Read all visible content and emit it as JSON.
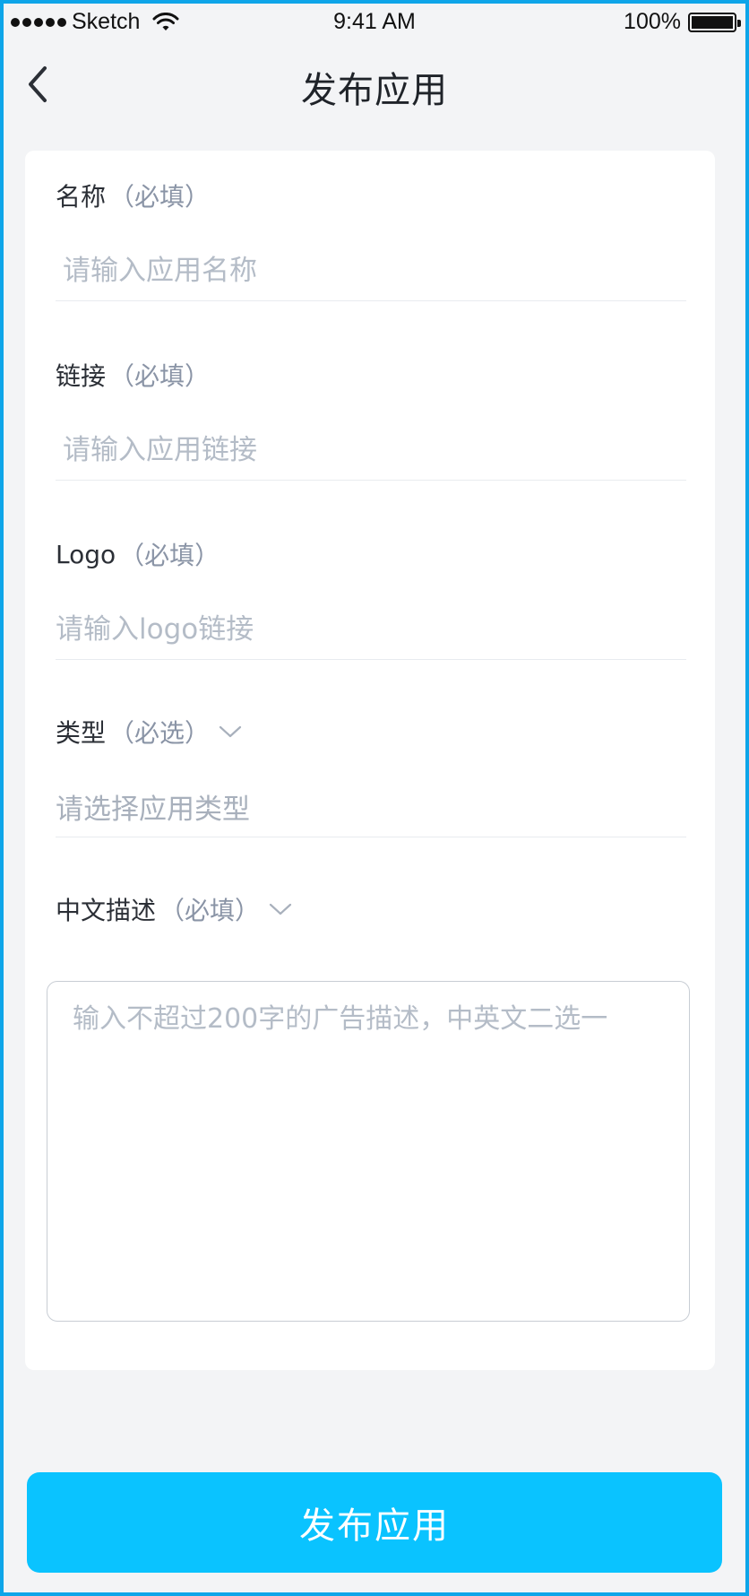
{
  "status_bar": {
    "carrier": "Sketch",
    "time": "9:41 AM",
    "battery": "100%",
    "battery_level": 1.0
  },
  "nav": {
    "title": "发布应用",
    "back_icon": "chevron-left-icon"
  },
  "form": {
    "name": {
      "label": "名称",
      "required": "（必填）",
      "placeholder": "请输入应用名称"
    },
    "link": {
      "label": "链接",
      "required": "（必填）",
      "placeholder": "请输入应用链接"
    },
    "logo": {
      "label": "Logo",
      "required": "（必填）",
      "placeholder": "请输入logo链接"
    },
    "type": {
      "label": "类型",
      "required": "（必选）",
      "placeholder": "请选择应用类型",
      "icon": "chevron-down-icon"
    },
    "description": {
      "label": "中文描述",
      "required": "（必填）",
      "placeholder": "输入不超过200字的广告描述，中英文二选一",
      "icon": "chevron-down-icon"
    }
  },
  "submit_label": "发布应用",
  "colors": {
    "accent": "#0ac3ff",
    "background": "#f3f4f6",
    "frame": "#0ea5e9"
  }
}
